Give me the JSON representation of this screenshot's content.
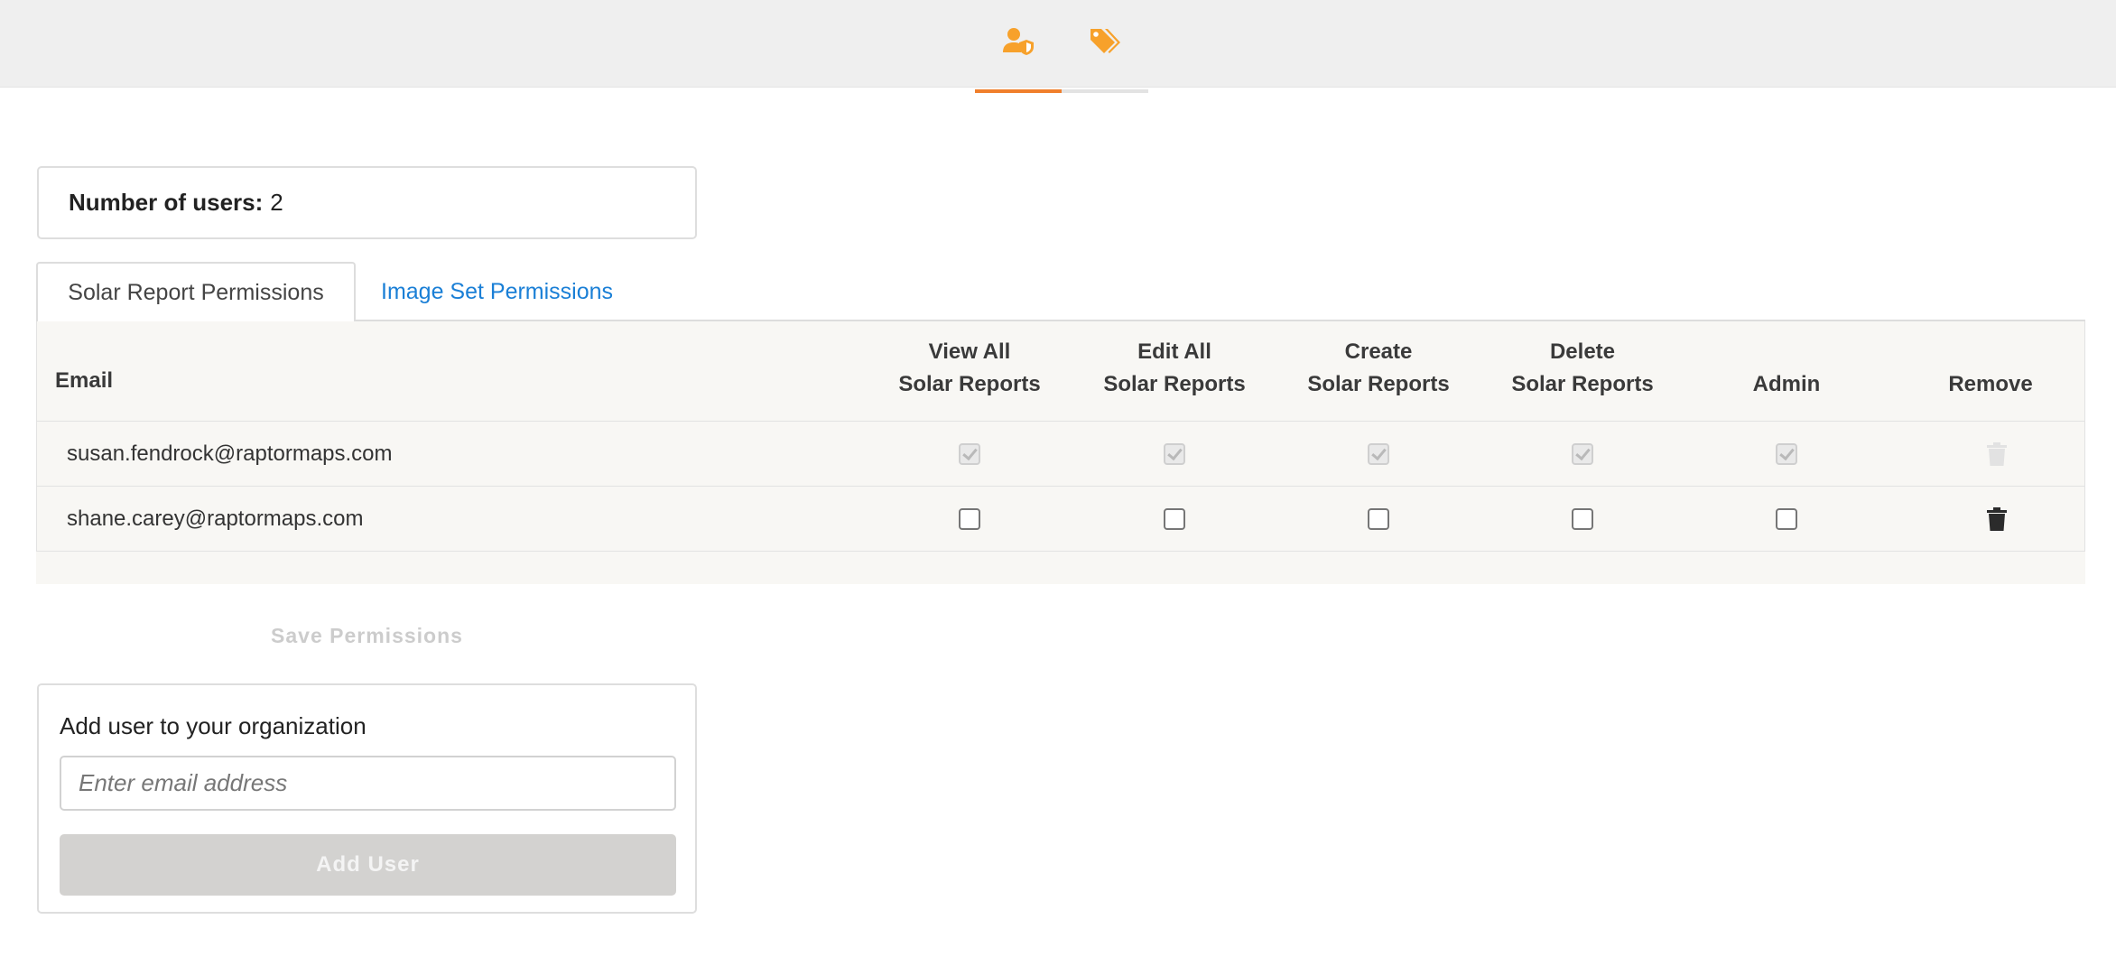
{
  "nav": {
    "tabs": [
      {
        "icon": "user-shield-icon",
        "active": true
      },
      {
        "icon": "tags-icon",
        "active": false
      }
    ],
    "accent_color": "#f7a12b",
    "active_underline_color": "#f07f2c"
  },
  "summary": {
    "label": "Number of users:",
    "value": "2"
  },
  "permission_tabs": [
    {
      "label": "Solar Report Permissions",
      "active": true
    },
    {
      "label": "Image Set Permissions",
      "active": false
    }
  ],
  "table": {
    "email_header": "Email",
    "columns": [
      {
        "line1": "View All",
        "line2": "Solar Reports"
      },
      {
        "line1": "Edit All",
        "line2": "Solar Reports"
      },
      {
        "line1": "Create",
        "line2": "Solar Reports"
      },
      {
        "line1": "Delete",
        "line2": "Solar Reports"
      },
      {
        "line1": "",
        "line2": "Admin"
      },
      {
        "line1": "",
        "line2": "Remove"
      }
    ],
    "rows": [
      {
        "email": "susan.fendrock@raptormaps.com",
        "permissions": [
          true,
          true,
          true,
          true,
          true
        ],
        "locked": true
      },
      {
        "email": "shane.carey@raptormaps.com",
        "permissions": [
          false,
          false,
          false,
          false,
          false
        ],
        "locked": false
      }
    ]
  },
  "save_label": "Save Permissions",
  "add_user": {
    "title": "Add user to your organization",
    "placeholder": "Enter email address",
    "button_label": "Add User"
  }
}
